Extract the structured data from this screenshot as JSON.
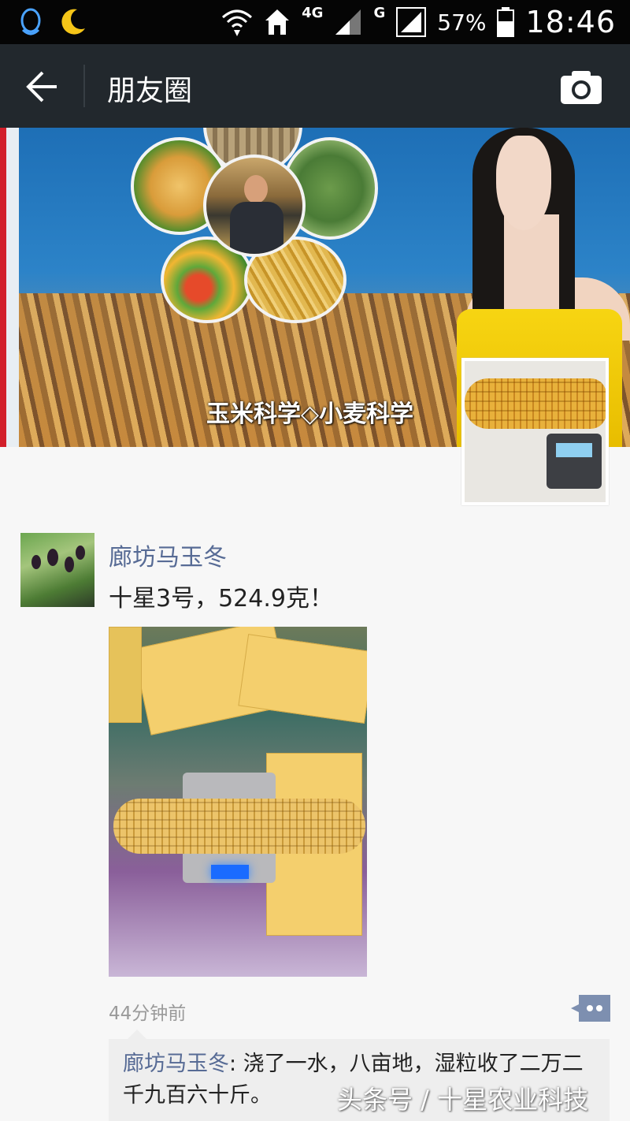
{
  "status_bar": {
    "network_type": "4G",
    "network_g": "G",
    "battery": "57%",
    "time": "18:46",
    "icons": [
      "qq-icon",
      "moon-icon",
      "wifi-icon",
      "home-icon",
      "signal-icon",
      "signal-icon",
      "battery-icon"
    ]
  },
  "header": {
    "title": "朋友圈"
  },
  "cover": {
    "caption": "玉米科学◇小麦科学"
  },
  "post": {
    "author": "廊坊马玉冬",
    "text": "十星3号，524.9克！",
    "time": "44分钟前"
  },
  "comments": [
    {
      "author": "廊坊马玉冬",
      "separator": ": ",
      "text": "浇了一水，八亩地，湿粒收了二万二千九百六十斤。"
    }
  ],
  "watermark": "头条号 / 十星农业科技",
  "colors": {
    "link": "#576b95",
    "header_bg": "#22282d",
    "status_bg": "#050505",
    "page_bg": "#f7f7f7"
  }
}
